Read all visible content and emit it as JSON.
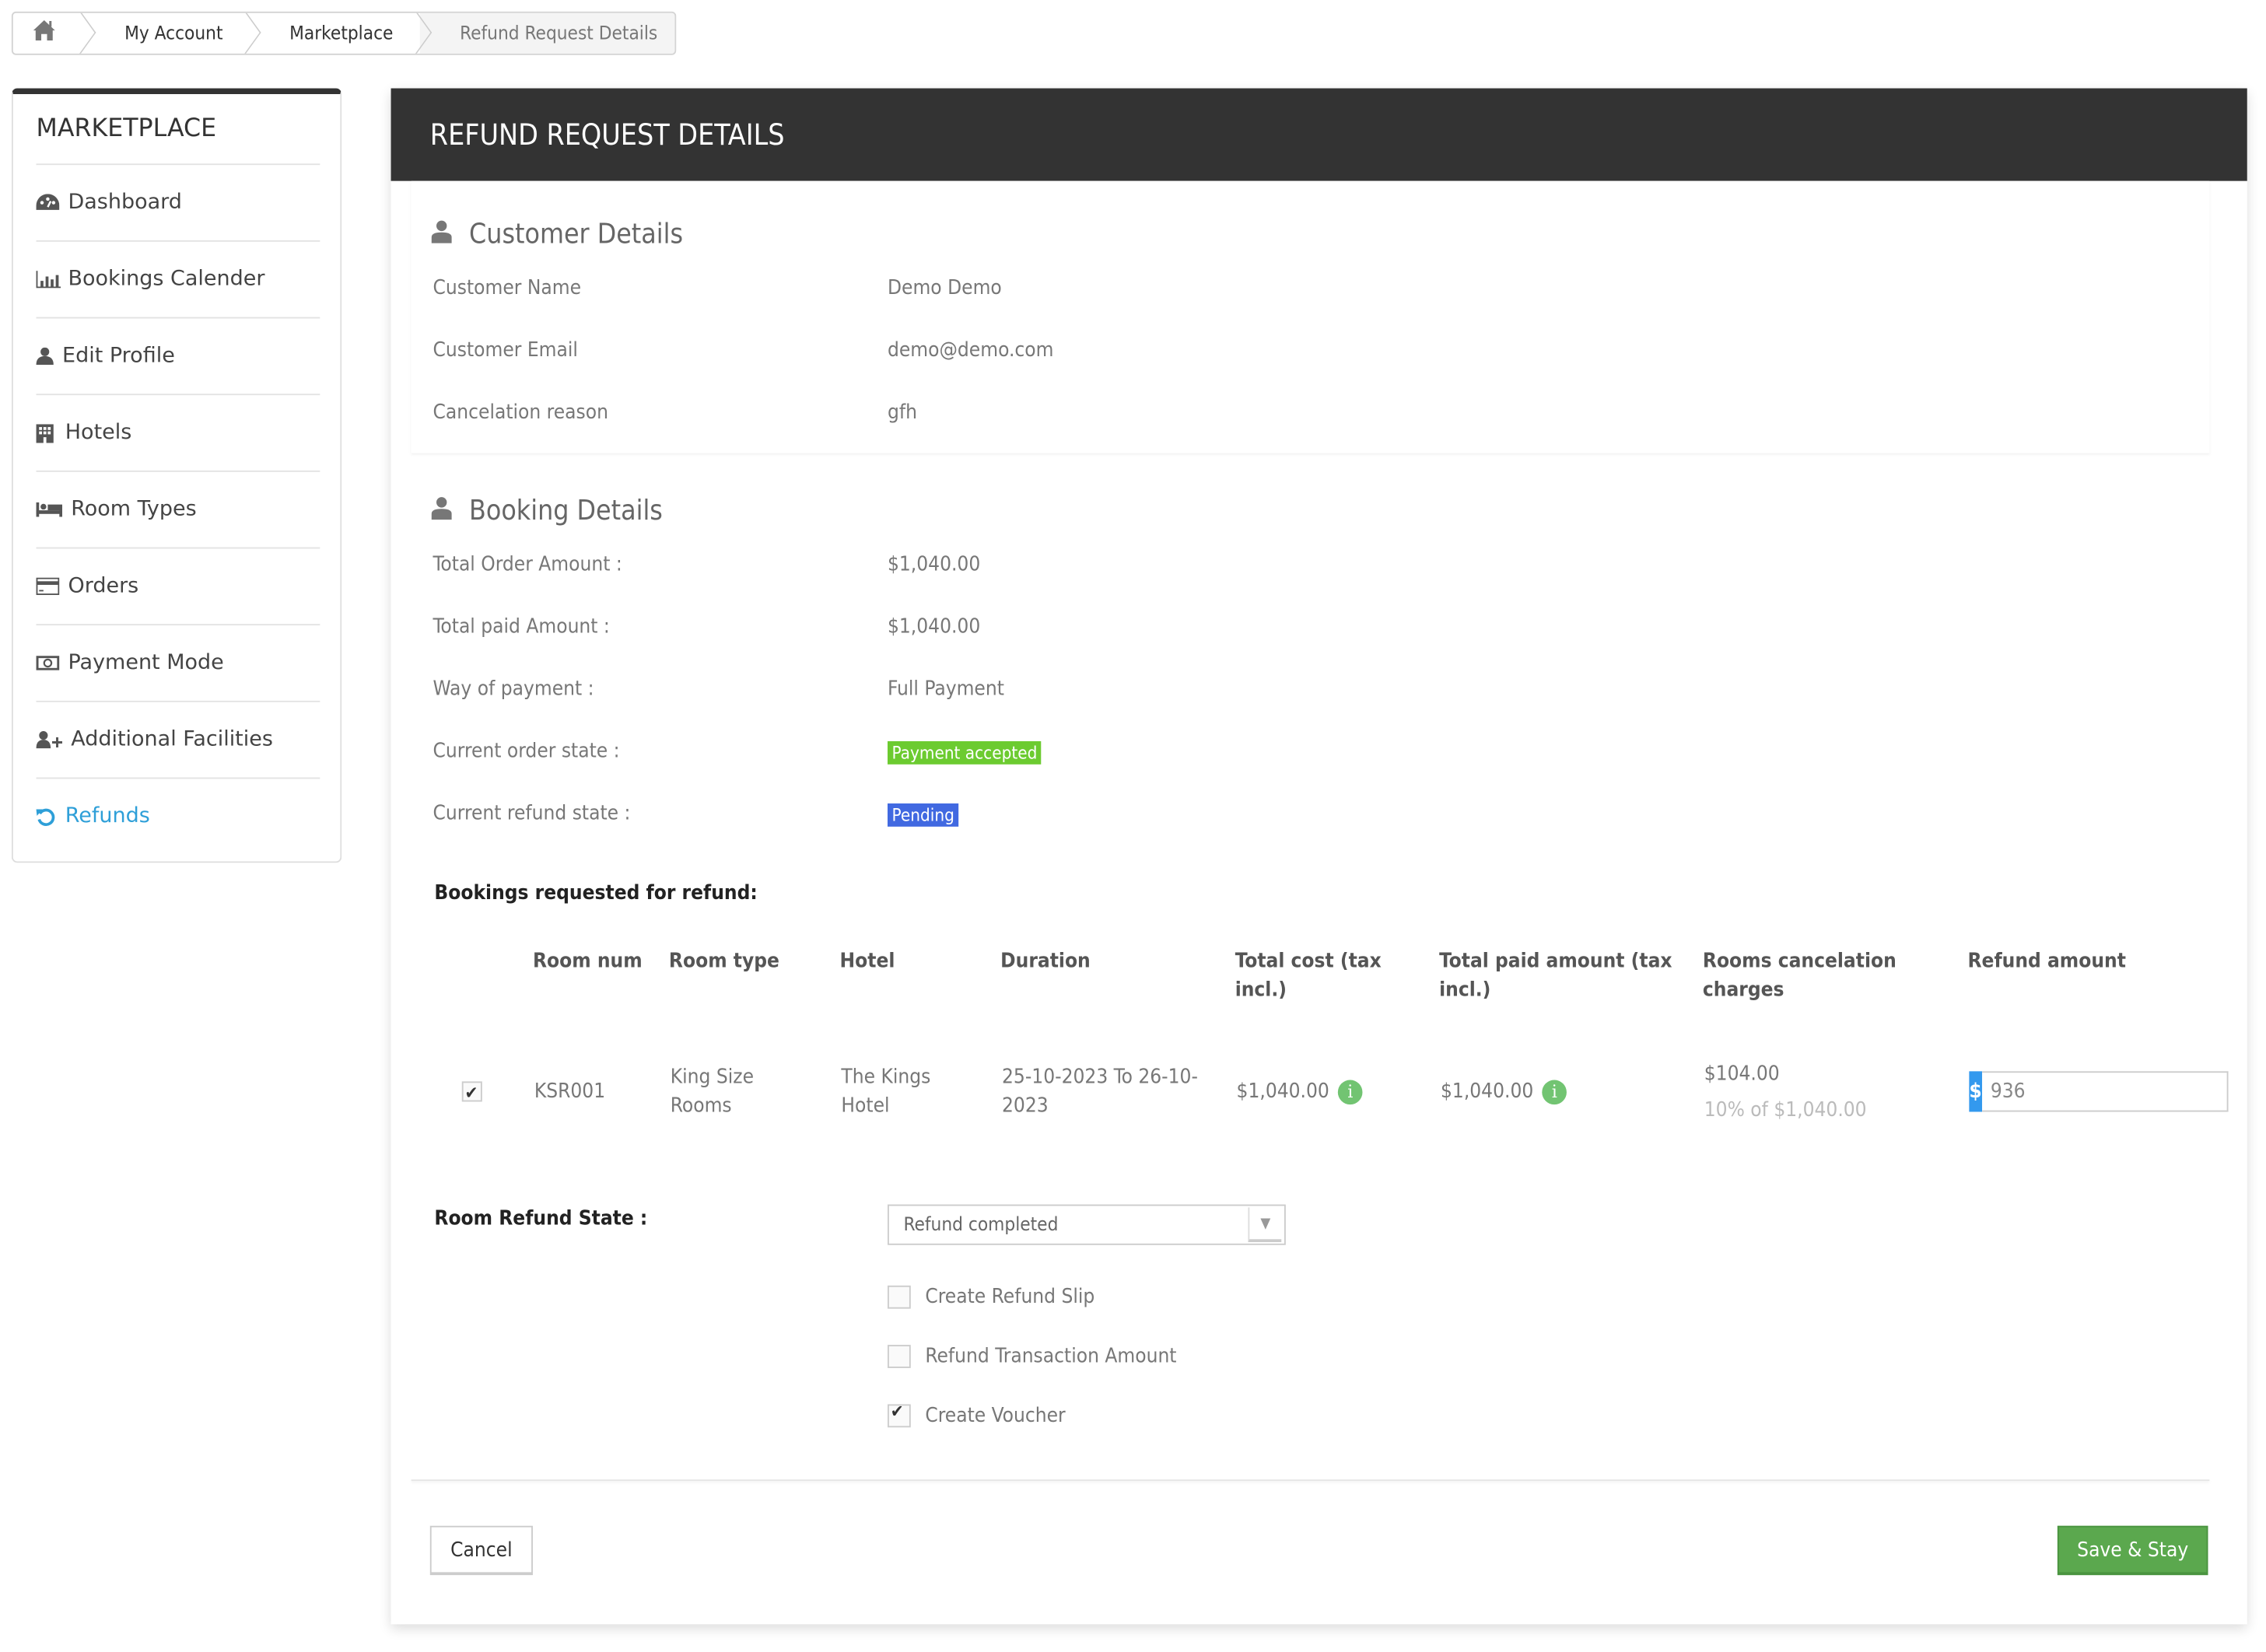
{
  "breadcrumb": {
    "home_icon": "home-icon",
    "items": [
      "My Account",
      "Marketplace",
      "Refund Request Details"
    ]
  },
  "sidebar": {
    "title": "MARKETPLACE",
    "items": [
      {
        "label": "Dashboard",
        "icon": "dashboard-icon",
        "active": false
      },
      {
        "label": "Bookings Calender",
        "icon": "bar-chart-icon",
        "active": false
      },
      {
        "label": "Edit Profile",
        "icon": "user-icon",
        "active": false
      },
      {
        "label": "Hotels",
        "icon": "building-icon",
        "active": false
      },
      {
        "label": "Room Types",
        "icon": "bed-icon",
        "active": false
      },
      {
        "label": "Orders",
        "icon": "credit-card-icon",
        "active": false
      },
      {
        "label": "Payment Mode",
        "icon": "money-icon",
        "active": false
      },
      {
        "label": "Additional Facilities",
        "icon": "user-plus-icon",
        "active": false
      },
      {
        "label": "Refunds",
        "icon": "undo-icon",
        "active": true
      }
    ]
  },
  "panel": {
    "title": "REFUND REQUEST DETAILS"
  },
  "customer": {
    "title": "Customer Details",
    "rows": [
      {
        "label": "Customer Name",
        "value": "Demo Demo"
      },
      {
        "label": "Customer Email",
        "value": "demo@demo.com"
      },
      {
        "label": "Cancelation reason",
        "value": "gfh"
      }
    ]
  },
  "booking": {
    "title": "Booking Details",
    "total_order_label": "Total Order Amount :",
    "total_order_value": "$1,040.00",
    "total_paid_label": "Total paid Amount :",
    "total_paid_value": "$1,040.00",
    "way_label": "Way of payment :",
    "way_value": "Full Payment",
    "order_state_label": "Current order state :",
    "order_state_value": "Payment accepted",
    "order_state_color": "#6ccb30",
    "refund_state_label": "Current refund state :",
    "refund_state_value": "Pending",
    "refund_state_color": "#4169e1"
  },
  "bookings_table": {
    "heading": "Bookings requested for refund:",
    "columns": [
      "Room num",
      "Room type",
      "Hotel",
      "Duration",
      "Total cost (tax incl.)",
      "Total paid amount (tax incl.)",
      "Rooms cancelation charges",
      "Refund amount"
    ],
    "rows": [
      {
        "selected": true,
        "room_num": "KSR001",
        "room_type": "King Size Rooms",
        "hotel": "The Kings Hotel",
        "duration": "25-10-2023 To 26-10-2023",
        "total_cost": "$1,040.00",
        "total_paid": "$1,040.00",
        "cancel_charge": "$104.00",
        "cancel_charge_note": "10% of $1,040.00",
        "currency_symbol": "$",
        "refund_amount": "936"
      }
    ]
  },
  "refund_form": {
    "state_label": "Room Refund State :",
    "state_selected": "Refund completed",
    "options": [
      {
        "label": "Create Refund Slip",
        "checked": false
      },
      {
        "label": "Refund Transaction Amount",
        "checked": false
      },
      {
        "label": "Create Voucher",
        "checked": true
      }
    ]
  },
  "footer": {
    "cancel_label": "Cancel",
    "save_label": "Save & Stay"
  }
}
